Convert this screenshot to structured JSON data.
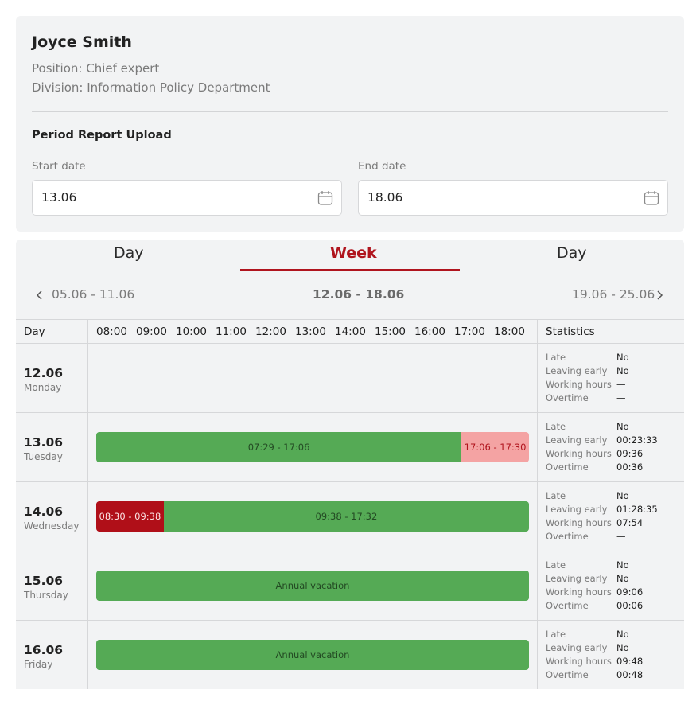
{
  "profile": {
    "name": "Joyce Smith",
    "position": "Position: Chief expert",
    "division": "Division: Information Policy Department"
  },
  "report": {
    "title": "Period Report Upload",
    "start_label": "Start date",
    "start_value": "13.06",
    "end_label": "End date",
    "end_value": "18.06"
  },
  "tabs": [
    {
      "label": "Day",
      "active": false
    },
    {
      "label": "Week",
      "active": true
    },
    {
      "label": "Day",
      "active": false
    }
  ],
  "weeks": {
    "prev": "05.06 - 11.06",
    "current": "12.06 - 18.06",
    "next": "19.06 - 25.06"
  },
  "grid": {
    "day_header": "Day",
    "stats_header": "Statistics",
    "hours": [
      "08:00",
      "09:00",
      "10:00",
      "11:00",
      "12:00",
      "13:00",
      "14:00",
      "15:00",
      "16:00",
      "17:00",
      "18:00"
    ],
    "stat_labels": [
      "Late",
      "Leaving early",
      "Working hours",
      "Overtime"
    ]
  },
  "days": [
    {
      "date": "12.06",
      "weekday": "Monday",
      "segments": [],
      "stats": [
        "No",
        "No",
        "—",
        "—"
      ]
    },
    {
      "date": "13.06",
      "weekday": "Tuesday",
      "segments": [
        {
          "label": "07:29 - 17:06",
          "kind": "green",
          "from": 0,
          "to": 0.844
        },
        {
          "label": "17:06 - 17:30",
          "kind": "pink",
          "from": 0.844,
          "to": 1
        }
      ],
      "stats": [
        "No",
        "00:23:33",
        "09:36",
        "00:36"
      ]
    },
    {
      "date": "14.06",
      "weekday": "Wednesday",
      "segments": [
        {
          "label": "08:30 - 09:38",
          "kind": "red",
          "from": 0,
          "to": 0.156
        },
        {
          "label": "09:38 - 17:32",
          "kind": "green",
          "from": 0.156,
          "to": 1
        }
      ],
      "stats": [
        "No",
        "01:28:35",
        "07:54",
        "—"
      ]
    },
    {
      "date": "15.06",
      "weekday": "Thursday",
      "segments": [
        {
          "label": "Annual vacation",
          "kind": "green",
          "from": 0,
          "to": 1
        }
      ],
      "stats": [
        "No",
        "No",
        "09:06",
        "00:06"
      ]
    },
    {
      "date": "16.06",
      "weekday": "Friday",
      "segments": [
        {
          "label": "Annual vacation",
          "kind": "green",
          "from": 0,
          "to": 1
        }
      ],
      "stats": [
        "No",
        "No",
        "09:48",
        "00:48"
      ]
    }
  ],
  "colors": {
    "accent": "#b0141d",
    "green": "#55aa55",
    "pink": "#f4a3a3",
    "red": "#b00f18"
  }
}
